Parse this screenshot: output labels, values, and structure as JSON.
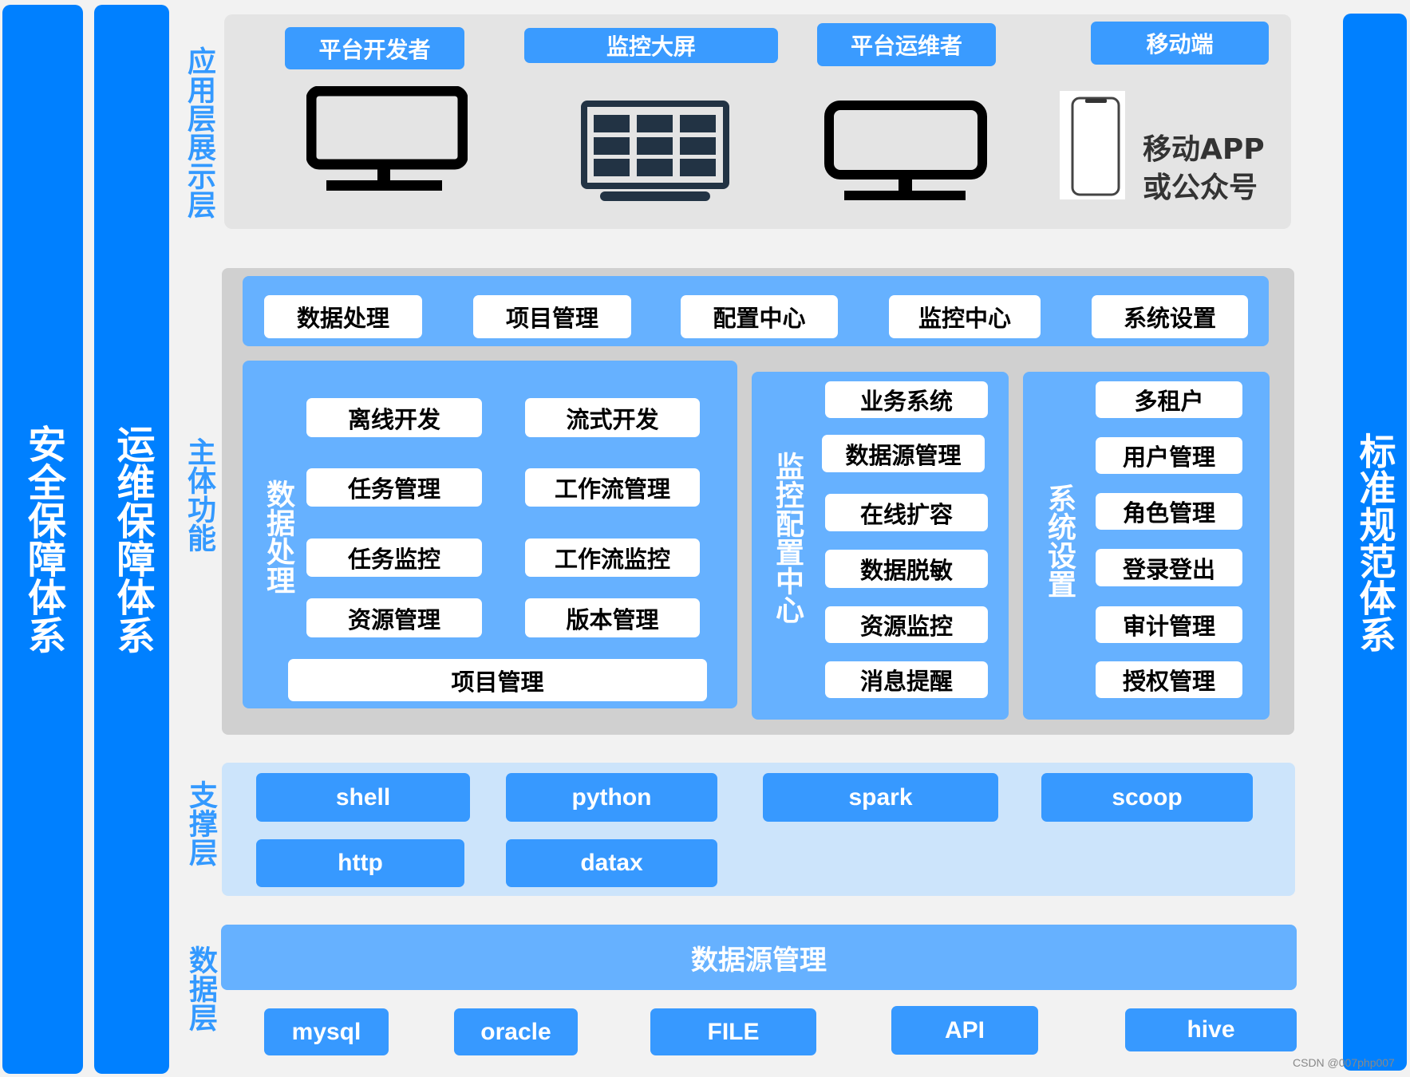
{
  "pillars": {
    "security": "安全保障体系",
    "operations": "运维保障体系",
    "standards": "标准规范体系"
  },
  "layers": {
    "application": {
      "label": "应用层展示层",
      "tags": [
        "平台开发者",
        "监控大屏",
        "平台运维者",
        "移动端"
      ],
      "icons": [
        "monitor-icon",
        "dashboard-screen-icon",
        "monitor-icon",
        "smartphone-icon"
      ],
      "mobile_text_line1": "移动APP",
      "mobile_text_line2": "或公众号"
    },
    "core": {
      "label": "主体功能",
      "top_modules": [
        "数据处理",
        "项目管理",
        "配置中心",
        "监控中心",
        "系统设置"
      ],
      "data_processing": {
        "label": "数据处理",
        "items": [
          "离线开发",
          "流式开发",
          "任务管理",
          "工作流管理",
          "任务监控",
          "工作流监控",
          "资源管理",
          "版本管理"
        ],
        "footer": "项目管理"
      },
      "monitor_config": {
        "label": "监控配置中心",
        "items": [
          "业务系统",
          "数据源管理",
          "在线扩容",
          "数据脱敏",
          "资源监控",
          "消息提醒"
        ]
      },
      "system_settings": {
        "label": "系统设置",
        "items": [
          "多租户",
          "用户管理",
          "角色管理",
          "登录登出",
          "审计管理",
          "授权管理"
        ]
      }
    },
    "support": {
      "label": "支撑层",
      "items": [
        "shell",
        "python",
        "spark",
        "scoop",
        "http",
        "datax"
      ]
    },
    "data": {
      "label": "数据层",
      "bar": "数据源管理",
      "sources": [
        "mysql",
        "oracle",
        "FILE",
        "API",
        "hive"
      ]
    }
  },
  "watermark": "CSDN @007php007",
  "colors": {
    "pillar": "#0080ff",
    "label": "#3399ff",
    "tag": "#3a9bff",
    "inner_panel": "#66b1ff",
    "support_panel": "#cce4fb",
    "core_panel": "#d0d0d0",
    "app_panel": "#e4e4e4"
  }
}
